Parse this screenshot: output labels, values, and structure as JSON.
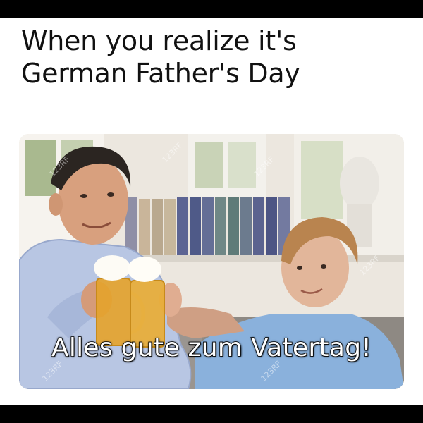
{
  "caption": {
    "line1": "When you realize it's",
    "line2": "German Father's Day"
  },
  "photo": {
    "overlay_text": "Alles gute zum Vatertag!",
    "watermark": "123RF"
  },
  "colors": {
    "background": "#000000",
    "panel": "#ffffff",
    "caption_text": "#111111",
    "overlay_text": "#ffffff"
  }
}
